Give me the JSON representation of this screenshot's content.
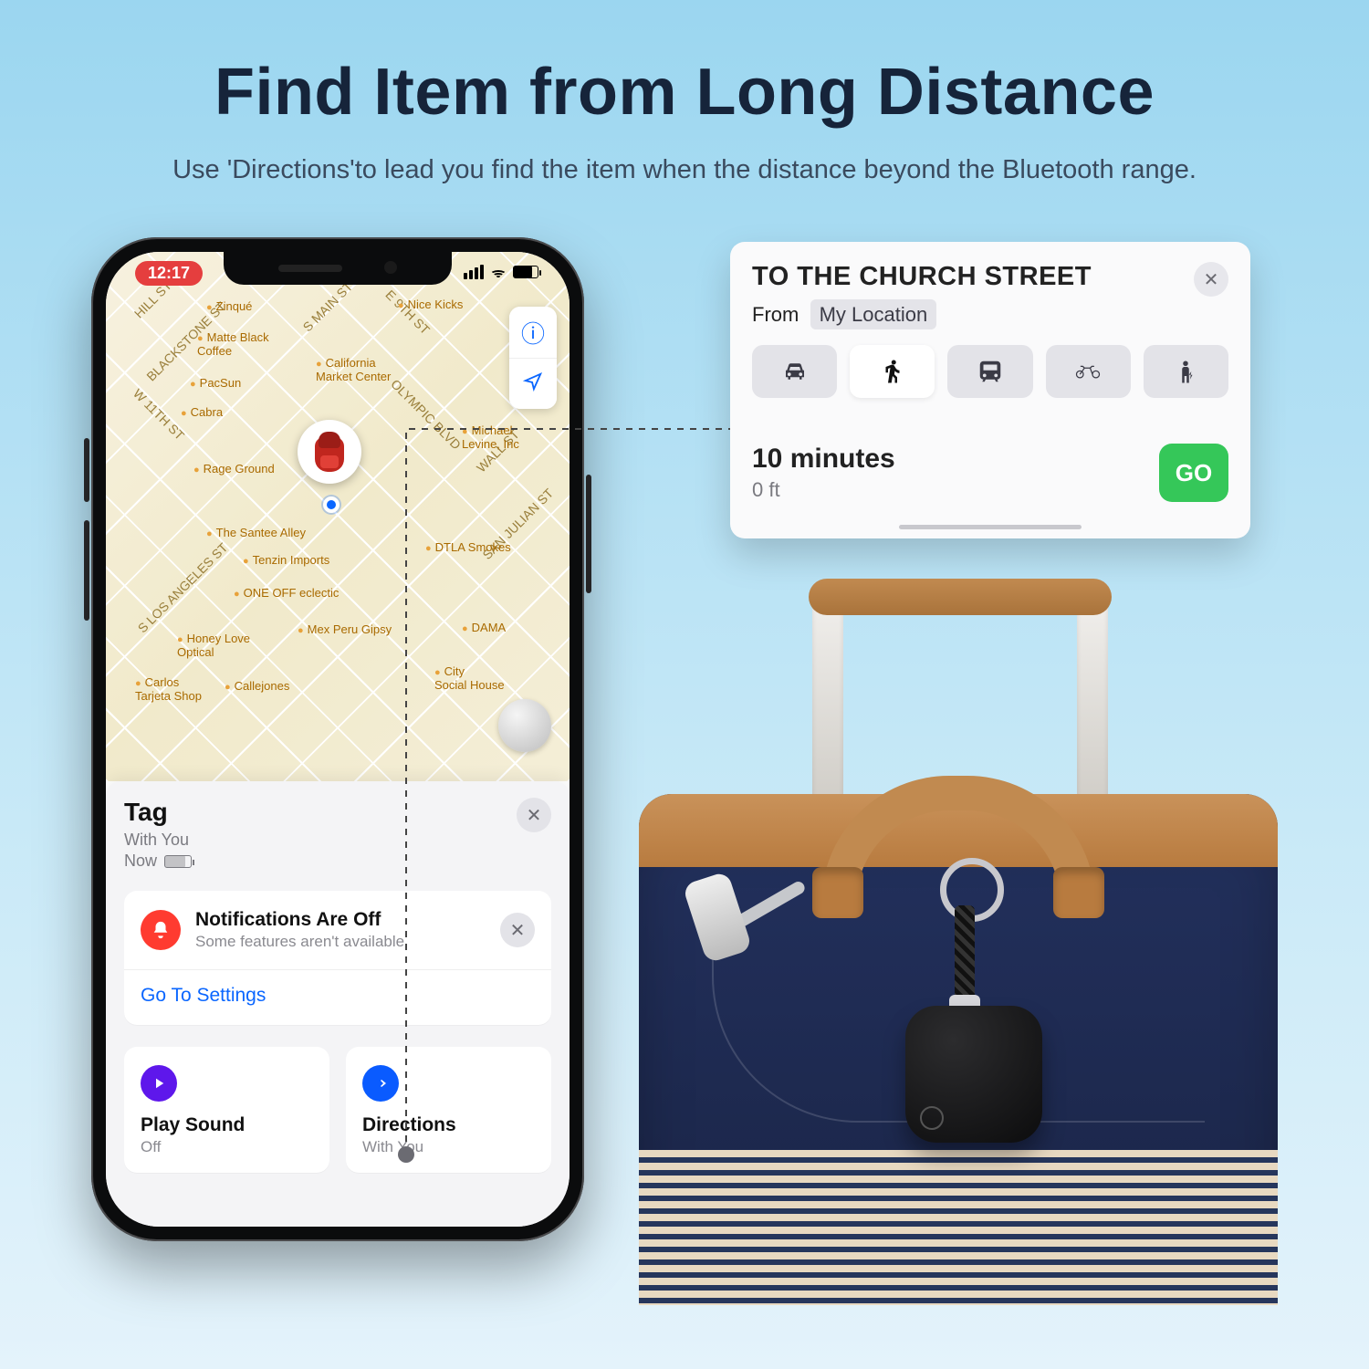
{
  "hero": {
    "title": "Find Item from Long Distance",
    "subtitle": "Use 'Directions'to lead you find the item when the distance beyond the Bluetooth range."
  },
  "phone": {
    "status": {
      "time": "12:17"
    },
    "map": {
      "pois": {
        "zinque": "Zinqué",
        "nice_kicks": "Nice Kicks",
        "matte_black": "Matte Black\nCoffee",
        "pacsun": "PacSun",
        "cabra": "Cabra",
        "cal_market": "California\nMarket Center",
        "rage_ground": "Rage Ground",
        "levine": "Michael\nLevine, Inc",
        "santee": "The Santee Alley",
        "tenzin": "Tenzin Imports",
        "dtla": "DTLA Smokes",
        "one_off": "ONE OFF eclectic",
        "mex_peru": "Mex Peru Gipsy",
        "dama": "DAMA",
        "honey_love": "Honey Love\nOptical",
        "callejones": "Callejones",
        "carlos": "Carlos\nTarjeta Shop",
        "social": "City\nSocial House"
      },
      "streets": {
        "main": "S MAIN ST",
        "ninth": "E 9TH ST",
        "wall": "WALL ST",
        "eleventh": "W 11TH ST",
        "sanjulian": "SAN JULIAN ST",
        "blackstone": "BLACKSTONE ST",
        "hill": "HILL ST",
        "sla": "S LOS ANGELES ST",
        "olympic": "OLYMPIC BLVD"
      }
    },
    "sheet": {
      "title": "Tag",
      "subtitle": "With You",
      "now": "Now",
      "notice_title": "Notifications Are Off",
      "notice_sub": "Some features aren't available",
      "notice_link": "Go To Settings",
      "actions": {
        "play": {
          "title": "Play Sound",
          "sub": "Off"
        },
        "directions": {
          "title": "Directions",
          "sub": "With You"
        }
      }
    }
  },
  "directions_card": {
    "title": "TO THE CHURCH STREET",
    "from_label": "From",
    "from_value": "My Location",
    "eta": "10 minutes",
    "dist": "0 ft",
    "go": "GO"
  }
}
